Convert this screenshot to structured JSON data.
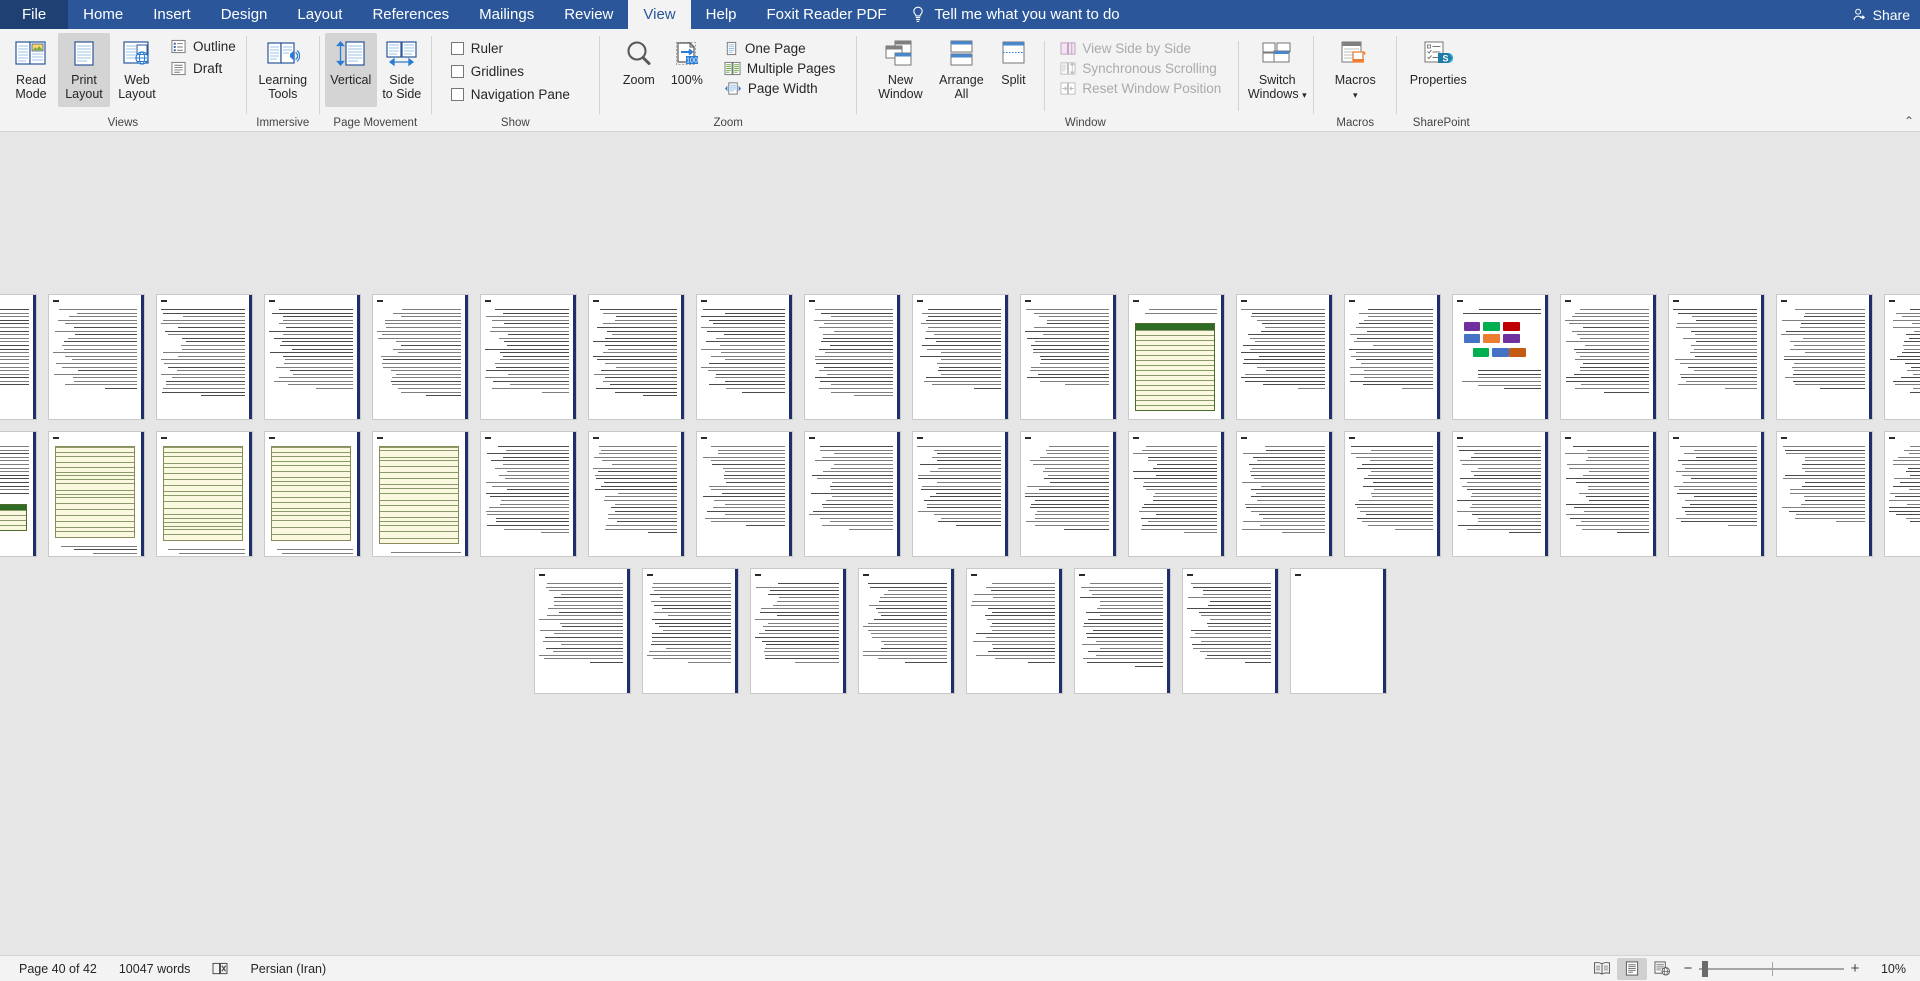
{
  "window": {
    "tabs": [
      {
        "label": "File",
        "active": false,
        "file": true
      },
      {
        "label": "Home",
        "active": false
      },
      {
        "label": "Insert",
        "active": false
      },
      {
        "label": "Design",
        "active": false
      },
      {
        "label": "Layout",
        "active": false
      },
      {
        "label": "References",
        "active": false
      },
      {
        "label": "Mailings",
        "active": false
      },
      {
        "label": "Review",
        "active": false
      },
      {
        "label": "View",
        "active": true
      },
      {
        "label": "Help",
        "active": false
      },
      {
        "label": "Foxit Reader PDF",
        "active": false
      }
    ],
    "tell_me": "Tell me what you want to do",
    "share": "Share",
    "collapse_ribbon": "⌃"
  },
  "ribbon": {
    "groups": [
      {
        "name": "Views",
        "label": "Views",
        "buttons": [
          {
            "label": "Read\nMode",
            "icon": "read-mode-icon",
            "selected": false
          },
          {
            "label": "Print\nLayout",
            "icon": "print-layout-icon",
            "selected": true
          },
          {
            "label": "Web\nLayout",
            "icon": "web-layout-icon",
            "selected": false
          }
        ],
        "checks": [
          {
            "label": "Outline",
            "icon": "outline-icon",
            "checked": false
          },
          {
            "label": "Draft",
            "icon": "draft-icon",
            "checked": false
          }
        ]
      },
      {
        "name": "Immersive",
        "label": "Immersive",
        "buttons": [
          {
            "label": "Learning\nTools",
            "icon": "learning-tools-icon",
            "selected": false
          }
        ]
      },
      {
        "name": "Page Movement",
        "label": "Page Movement",
        "buttons": [
          {
            "label": "Vertical",
            "icon": "vertical-scroll-icon",
            "selected": true
          },
          {
            "label": "Side\nto Side",
            "icon": "side-to-side-icon",
            "selected": false
          }
        ]
      },
      {
        "name": "Show",
        "label": "Show",
        "checks": [
          {
            "label": "Ruler",
            "checked": false
          },
          {
            "label": "Gridlines",
            "checked": false
          },
          {
            "label": "Navigation Pane",
            "checked": false
          }
        ]
      },
      {
        "name": "Zoom",
        "label": "Zoom",
        "buttons": [
          {
            "label": "Zoom",
            "icon": "zoom-magnifier-icon",
            "selected": false
          },
          {
            "label": "100%",
            "icon": "zoom-100-icon",
            "selected": false
          }
        ],
        "items": [
          {
            "label": "One Page",
            "icon": "one-page-icon"
          },
          {
            "label": "Multiple Pages",
            "icon": "multiple-pages-icon"
          },
          {
            "label": "Page Width",
            "icon": "page-width-icon"
          }
        ]
      },
      {
        "name": "Window",
        "label": "Window",
        "buttons": [
          {
            "label": "New\nWindow",
            "icon": "new-window-icon"
          },
          {
            "label": "Arrange\nAll",
            "icon": "arrange-all-icon"
          },
          {
            "label": "Split",
            "icon": "split-icon"
          }
        ],
        "items": [
          {
            "label": "View Side by Side",
            "icon": "view-side-by-side-icon",
            "disabled": true
          },
          {
            "label": "Synchronous Scrolling",
            "icon": "synchronous-scrolling-icon",
            "disabled": true
          },
          {
            "label": "Reset Window Position",
            "icon": "reset-window-position-icon",
            "disabled": true
          }
        ],
        "switch": {
          "label": "Switch\nWindows",
          "icon": "switch-windows-icon",
          "dropdown": true
        }
      },
      {
        "name": "Macros",
        "label": "Macros",
        "buttons": [
          {
            "label": "Macros",
            "icon": "macros-icon",
            "dropdown": true
          }
        ]
      },
      {
        "name": "SharePoint",
        "label": "SharePoint",
        "buttons": [
          {
            "label": "Properties",
            "icon": "properties-icon"
          }
        ]
      }
    ]
  },
  "document": {
    "rows": [
      {
        "count": 19,
        "specials": {
          "11": "table",
          "14": "diagram"
        }
      },
      {
        "count": 19,
        "specials": {
          "0": "green-table",
          "1": "form-table",
          "2": "form-table",
          "3": "form-table",
          "4": "form-table"
        }
      },
      {
        "count": 8,
        "specials": {
          "7": "blank"
        }
      }
    ]
  },
  "status": {
    "page": "Page 40 of 42",
    "words": "10047 words",
    "proofing_icon": "proofing-errors-icon",
    "language": "Persian (Iran)",
    "views": [
      {
        "name": "read-mode-view-button",
        "active": false
      },
      {
        "name": "print-layout-view-button",
        "active": true
      },
      {
        "name": "web-layout-view-button",
        "active": false
      }
    ],
    "zoom_out": "−",
    "zoom_in": "+",
    "zoom_value": "10%"
  }
}
